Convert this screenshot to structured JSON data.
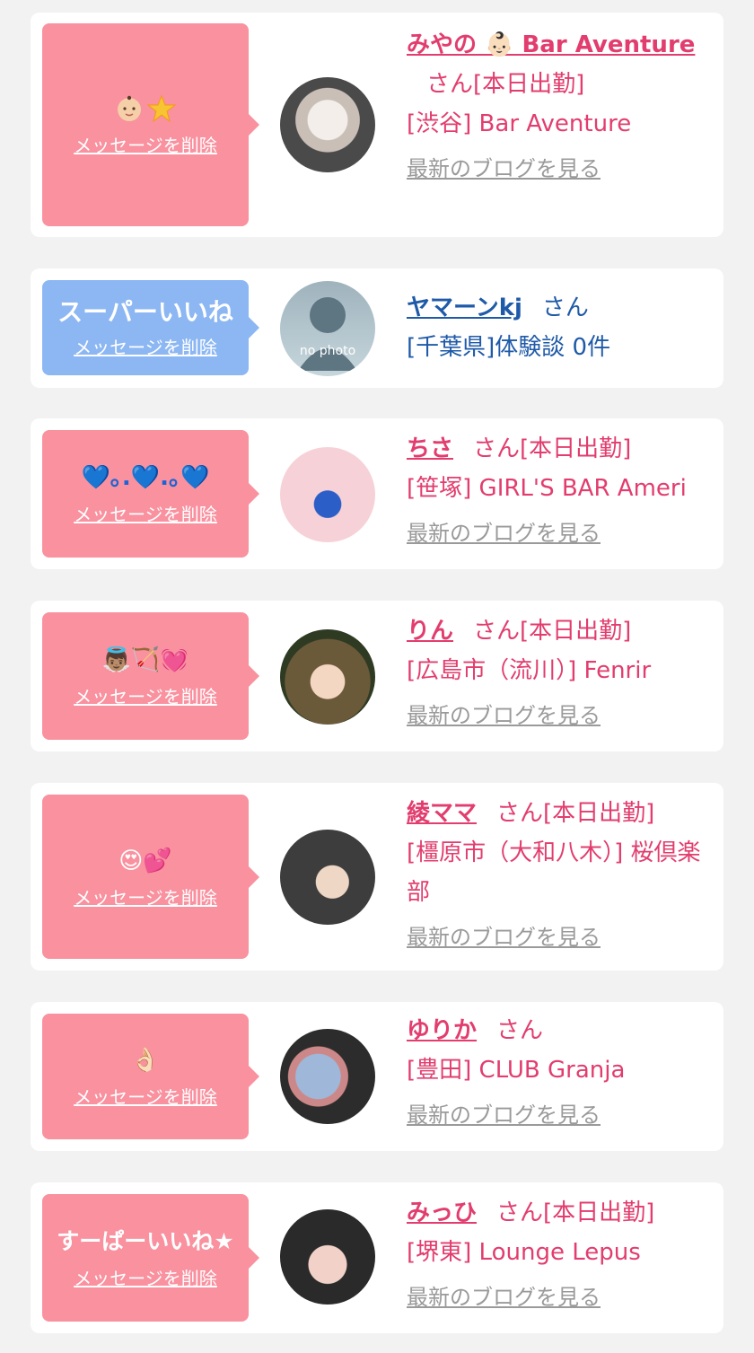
{
  "delete_label": "メッセージを削除",
  "blog_label": "最新のブログを見る",
  "honorific": "さん",
  "attendance": "[本日出勤]",
  "colors": {
    "pink_bubble": "#f9919f",
    "blue_bubble": "#8cb7f3",
    "pink_text": "#e23d6e",
    "blue_text": "#1f5aa8",
    "gray_link": "#9a9a9a"
  },
  "cards": [
    {
      "name": "みやの 👶🏻 Bar Aventure",
      "shop": "[渋谷] Bar Aventure",
      "message_emojis": "👶🏻🌟"
    },
    {
      "name": "ヤマーンkj",
      "shop": "[千葉県]体験談 0件",
      "message": "スーパーいいね",
      "avatar_text": "no photo"
    },
    {
      "name": "ちさ",
      "shop": "[笹塚] GIRL'S BAR Ameri",
      "message_emojis": "💙｡.💙.｡💙"
    },
    {
      "name": "りん",
      "shop": "[広島市（流川）] Fenrir",
      "message_emojis": "👼🏽🏹💓"
    },
    {
      "name": "綾ママ",
      "shop": "[橿原市（大和八木）] 桜倶楽部",
      "message_emojis": "😍💕"
    },
    {
      "name": "ゆりか",
      "shop": "[豊田] CLUB Granja",
      "message_emojis": "👌🏻"
    },
    {
      "name": "みっひ",
      "shop": "[堺東] Lounge Lepus",
      "message": "すーぱーいいね★"
    }
  ]
}
